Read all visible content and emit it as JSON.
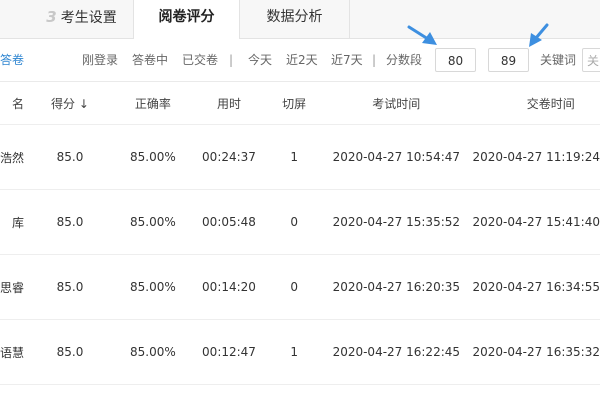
{
  "tabs": [
    {
      "num": "3",
      "label": "考生设置"
    },
    {
      "label": "阅卷评分"
    },
    {
      "label": "数据分析"
    }
  ],
  "filter": {
    "left_link": "答卷",
    "statuses": [
      "刚登录",
      "答卷中",
      "已交卷"
    ],
    "ranges": [
      "今天",
      "近2天",
      "近7天"
    ],
    "separator": "|",
    "score_label": "分数段",
    "score_min": "80",
    "score_max": "89",
    "keyword_label": "关键词",
    "keyword_placeholder": "关"
  },
  "table": {
    "headers": {
      "name": "名",
      "score": "得分",
      "score_sort": "↓",
      "accuracy": "正确率",
      "duration": "用时",
      "switch": "切屏",
      "exam_time": "考试时间",
      "submit_time": "交卷时间"
    },
    "rows": [
      {
        "name": "浩然",
        "score": "85.0",
        "accuracy": "85.00%",
        "duration": "00:24:37",
        "switch": "1",
        "exam_time": "2020-04-27 10:54:47",
        "submit_time": "2020-04-27 11:19:24"
      },
      {
        "name": "库",
        "score": "85.0",
        "accuracy": "85.00%",
        "duration": "00:05:48",
        "switch": "0",
        "exam_time": "2020-04-27 15:35:52",
        "submit_time": "2020-04-27 15:41:40"
      },
      {
        "name": "思睿",
        "score": "85.0",
        "accuracy": "85.00%",
        "duration": "00:14:20",
        "switch": "0",
        "exam_time": "2020-04-27 16:20:35",
        "submit_time": "2020-04-27 16:34:55"
      },
      {
        "name": "语慧",
        "score": "85.0",
        "accuracy": "85.00%",
        "duration": "00:12:47",
        "switch": "1",
        "exam_time": "2020-04-27 16:22:45",
        "submit_time": "2020-04-27 16:35:32"
      }
    ]
  },
  "colors": {
    "link": "#2f86d1",
    "annotation_arrow": "#3d8fe0"
  },
  "annotations": [
    "arrow-icon",
    "arrow-icon"
  ]
}
